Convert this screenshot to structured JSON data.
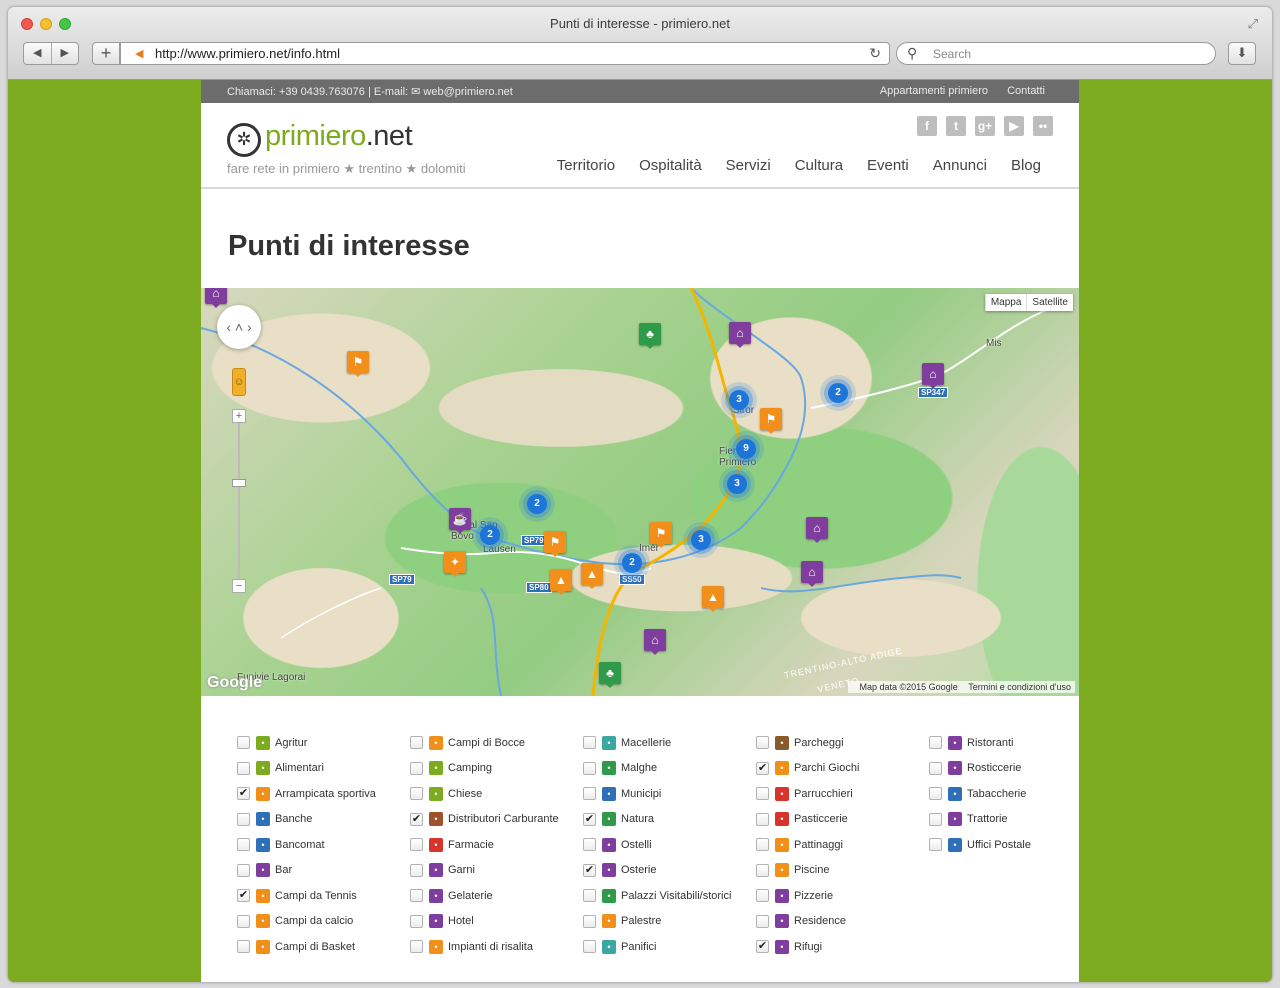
{
  "browser": {
    "title": "Punti di interesse - primiero.net",
    "url": "http://www.primiero.net/info.html",
    "search_placeholder": "Search"
  },
  "topbar": {
    "contact": "Chiamaci: +39 0439.763076 | E-mail: ✉ web@primiero.net",
    "links": [
      "Appartamenti primiero",
      "Contatti"
    ]
  },
  "header": {
    "logo_prefix": "primiero",
    "logo_suffix": ".net",
    "tagline": "fare rete in primiero ★ trentino ★ dolomiti",
    "social_icons": [
      "facebook-icon",
      "twitter-icon",
      "googleplus-icon",
      "youtube-icon",
      "flickr-icon"
    ],
    "nav": [
      "Territorio",
      "Ospitalità",
      "Servizi",
      "Cultura",
      "Eventi",
      "Annunci",
      "Blog"
    ]
  },
  "page_title": "Punti di interesse",
  "map": {
    "type_buttons": [
      "Mappa",
      "Satellite"
    ],
    "places": [
      {
        "name": "Mis"
      },
      {
        "name": "Siror"
      },
      {
        "name": "Fiera di Primiero"
      },
      {
        "name": "Imer"
      },
      {
        "name": "Canal San Bovo"
      },
      {
        "name": "Lausen"
      },
      {
        "name": "Funivie Lagorai"
      }
    ],
    "road_shields": [
      "SP79",
      "SP79",
      "SP80",
      "SS50",
      "SP347"
    ],
    "region": "TRENTINO-ALTO ADIGE",
    "region2": "VENETO",
    "clusters": [
      "3",
      "2",
      "9",
      "3",
      "2",
      "2",
      "3",
      "2"
    ],
    "logo": "Google",
    "attribution": "Map data ©2015 Google",
    "terms": "Termini e condizioni d'uso"
  },
  "categories": [
    [
      {
        "label": "Agritur",
        "checked": false,
        "color": "#7cab1f"
      },
      {
        "label": "Alimentari",
        "checked": false,
        "color": "#7cab1f"
      },
      {
        "label": "Arrampicata sportiva",
        "checked": true,
        "color": "#f28f1a"
      },
      {
        "label": "Banche",
        "checked": false,
        "color": "#2f6fb7"
      },
      {
        "label": "Bancomat",
        "checked": false,
        "color": "#2f6fb7"
      },
      {
        "label": "Bar",
        "checked": false,
        "color": "#7f3d9e"
      },
      {
        "label": "Campi da Tennis",
        "checked": true,
        "color": "#f28f1a"
      },
      {
        "label": "Campi da calcio",
        "checked": false,
        "color": "#f28f1a"
      },
      {
        "label": "Campi di Basket",
        "checked": false,
        "color": "#f28f1a"
      }
    ],
    [
      {
        "label": "Campi di Bocce",
        "checked": false,
        "color": "#f28f1a"
      },
      {
        "label": "Camping",
        "checked": false,
        "color": "#7cab1f"
      },
      {
        "label": "Chiese",
        "checked": false,
        "color": "#7cab1f"
      },
      {
        "label": "Distributori Carburante",
        "checked": true,
        "color": "#a0522d"
      },
      {
        "label": "Farmacie",
        "checked": false,
        "color": "#d9342b"
      },
      {
        "label": "Garni",
        "checked": false,
        "color": "#7f3d9e"
      },
      {
        "label": "Gelaterie",
        "checked": false,
        "color": "#7f3d9e"
      },
      {
        "label": "Hotel",
        "checked": false,
        "color": "#7f3d9e"
      },
      {
        "label": "Impianti di risalita",
        "checked": false,
        "color": "#f28f1a"
      }
    ],
    [
      {
        "label": "Macellerie",
        "checked": false,
        "color": "#3aa7a1"
      },
      {
        "label": "Malghe",
        "checked": false,
        "color": "#2e9a4a"
      },
      {
        "label": "Municipi",
        "checked": false,
        "color": "#2f6fb7"
      },
      {
        "label": "Natura",
        "checked": true,
        "color": "#2e9a4a"
      },
      {
        "label": "Ostelli",
        "checked": false,
        "color": "#7f3d9e"
      },
      {
        "label": "Osterie",
        "checked": true,
        "color": "#7f3d9e"
      },
      {
        "label": "Palazzi Visitabili/storici",
        "checked": false,
        "color": "#2e9a4a"
      },
      {
        "label": "Palestre",
        "checked": false,
        "color": "#f28f1a"
      },
      {
        "label": "Panifici",
        "checked": false,
        "color": "#3aa7a1"
      }
    ],
    [
      {
        "label": "Parcheggi",
        "checked": false,
        "color": "#8b5a2b"
      },
      {
        "label": "Parchi Giochi",
        "checked": true,
        "color": "#f28f1a"
      },
      {
        "label": "Parrucchieri",
        "checked": false,
        "color": "#d9342b"
      },
      {
        "label": "Pasticcerie",
        "checked": false,
        "color": "#d9342b"
      },
      {
        "label": "Pattinaggi",
        "checked": false,
        "color": "#f28f1a"
      },
      {
        "label": "Piscine",
        "checked": false,
        "color": "#f28f1a"
      },
      {
        "label": "Pizzerie",
        "checked": false,
        "color": "#7f3d9e"
      },
      {
        "label": "Residence",
        "checked": false,
        "color": "#7f3d9e"
      },
      {
        "label": "Rifugi",
        "checked": true,
        "color": "#7f3d9e"
      }
    ],
    [
      {
        "label": "Ristoranti",
        "checked": false,
        "color": "#7f3d9e"
      },
      {
        "label": "Rosticcerie",
        "checked": false,
        "color": "#7f3d9e"
      },
      {
        "label": "Tabaccherie",
        "checked": false,
        "color": "#2f6fb7"
      },
      {
        "label": "Trattorie",
        "checked": false,
        "color": "#7f3d9e"
      },
      {
        "label": "Uffici Postale",
        "checked": false,
        "color": "#2f6fb7"
      }
    ]
  ]
}
